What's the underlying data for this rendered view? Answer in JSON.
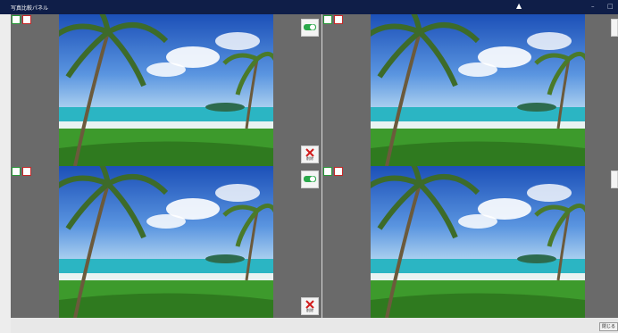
{
  "window": {
    "title": "写真比較パネル",
    "minimize_glyph": "–",
    "maximize_glyph": "□"
  },
  "tiles": [
    {
      "checkbox_left": "",
      "checkbox_right": "",
      "delete_label": "削除"
    },
    {
      "checkbox_left": "",
      "checkbox_right": ""
    },
    {
      "checkbox_left": "",
      "checkbox_right": "",
      "delete_label": "削除"
    },
    {
      "checkbox_left": "",
      "checkbox_right": ""
    }
  ],
  "icons": {
    "toggle": "toggle-icon",
    "delete": "delete-icon",
    "cursor": "cursor-icon",
    "close": "close-icon"
  },
  "footer": {
    "close_label": "閉じる"
  }
}
